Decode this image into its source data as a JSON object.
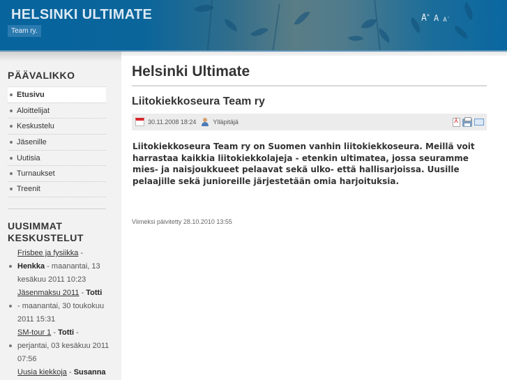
{
  "header": {
    "site_title": "HELSINKI ULTIMATE",
    "tagline": "Team ry.",
    "font_controls": {
      "increase": "A",
      "increase_sup": "+",
      "reset": "A",
      "decrease": "A",
      "decrease_sup": "-"
    }
  },
  "sidebar": {
    "menu_title": "PÄÄVALIKKO",
    "menu_items": [
      {
        "label": "Etusivu",
        "active": true
      },
      {
        "label": "Aloittelijat",
        "active": false
      },
      {
        "label": "Keskustelu",
        "active": false
      },
      {
        "label": "Jäsenille",
        "active": false
      },
      {
        "label": "Uutisia",
        "active": false
      },
      {
        "label": "Turnaukset",
        "active": false
      },
      {
        "label": "Treenit",
        "active": false
      }
    ],
    "latest_title_line1": "UUSIMMAT",
    "latest_title_line2": "KESKUSTELUT",
    "latest_posts": [
      {
        "topic": "Frisbee ja fysiikka",
        "author": "Henkka",
        "date": "maanantai, 13 kesäkuu 2011 10:23"
      },
      {
        "topic": "Jäsenmaksu 2011",
        "author": "Totti",
        "date": "maanantai, 30 toukokuu 2011 15:31"
      },
      {
        "topic": "SM-tour 1",
        "author": "Totti",
        "date": "perjantai, 03 kesäkuu 2011 07:56"
      },
      {
        "topic": "Uusia kiekkoja",
        "author": "Susanna",
        "date": ""
      }
    ],
    "separator": " - "
  },
  "main": {
    "page_heading": "Helsinki Ultimate",
    "article": {
      "title": "Liitokiekkoseura Team ry",
      "date": "30.11.2008 18:24",
      "author": "Ylläpitäjä",
      "actions": [
        "pdf-icon",
        "print-icon",
        "email-icon"
      ],
      "body": "Liitokiekkoseura Team ry on Suomen vanhin liitokiekkoseura. Meillä voit harrastaa kaikkia liitokiekkolajeja - etenkin ultimatea, jossa seuramme mies- ja naisjoukkueet pelaavat sekä ulko- että hallisarjoissa. Uusille pelaajille sekä junioreille järjestetään omia harjoituksia.",
      "modified": "Viimeksi päivitetty 28.10.2010 13:55"
    }
  }
}
